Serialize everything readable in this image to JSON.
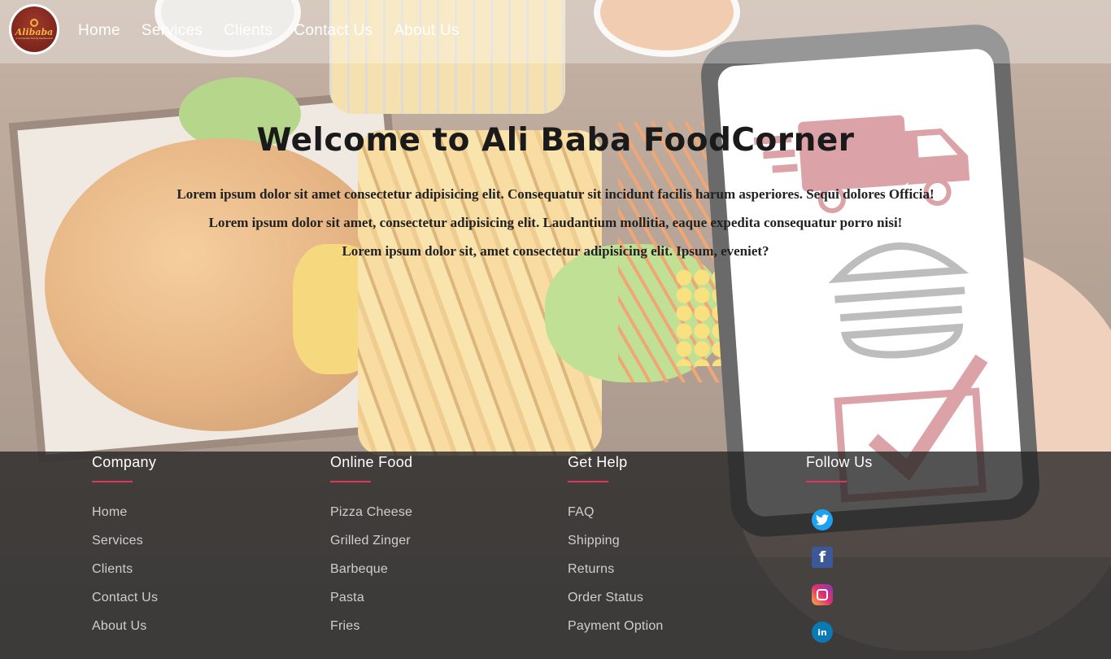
{
  "logo": {
    "text": "Alibaba",
    "tagline": "A Complete Family Restaurant"
  },
  "nav": [
    "Home",
    "Services",
    "Clients",
    "Contact Us",
    "About Us"
  ],
  "hero": {
    "title": "Welcome to Ali Baba FoodCorner",
    "lines": [
      "Lorem ipsum dolor sit amet consectetur adipisicing elit. Consequatur sit incidunt facilis harum asperiores. Sequi dolores Officia!",
      "Lorem ipsum dolor sit amet, consectetur adipisicing elit. Laudantium mollitia, eaque expedita consequatur porro nisi!",
      "Lorem ipsum dolor sit, amet consectetur adipisicing elit. Ipsum, eveniet?"
    ]
  },
  "footer": {
    "company": {
      "title": "Company",
      "items": [
        "Home",
        "Services",
        "Clients",
        "Contact Us",
        "About Us"
      ]
    },
    "online_food": {
      "title": "Online Food",
      "items": [
        "Pizza Cheese",
        "Grilled Zinger",
        "Barbeque",
        "Pasta",
        "Fries"
      ]
    },
    "get_help": {
      "title": "Get Help",
      "items": [
        "FAQ",
        "Shipping",
        "Returns",
        "Order Status",
        "Payment Option"
      ]
    },
    "follow_us": {
      "title": "Follow Us",
      "icons": [
        "twitter-icon",
        "facebook-icon",
        "instagram-icon",
        "linkedin-icon"
      ]
    }
  },
  "colors": {
    "accent": "#e23456",
    "footer_bg": "#232323"
  }
}
